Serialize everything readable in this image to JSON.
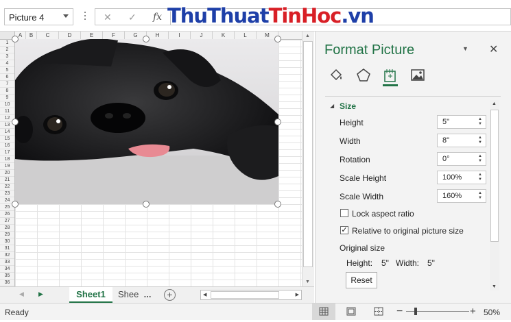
{
  "formula_bar": {
    "name_box": "Picture 4",
    "fx_label": "fx",
    "watermark_a": "ThuThuat",
    "watermark_b": "TinHoc",
    "watermark_c": ".vn"
  },
  "grid": {
    "columns": [
      "A",
      "B",
      "C",
      "D",
      "E",
      "F",
      "G",
      "H",
      "I",
      "J",
      "K",
      "L",
      "M"
    ],
    "rows": [
      "1",
      "2",
      "3",
      "4",
      "5",
      "6",
      "7",
      "8",
      "9",
      "10",
      "11",
      "12",
      "13",
      "14",
      "15",
      "16",
      "17",
      "18",
      "19",
      "20",
      "21",
      "22",
      "23",
      "24",
      "25",
      "26",
      "27",
      "28",
      "29",
      "30",
      "31",
      "32",
      "33",
      "34",
      "35",
      "36"
    ]
  },
  "sheet_tabs": {
    "active": "Sheet1",
    "other": "Shee",
    "ellipsis": "..."
  },
  "pane": {
    "title": "Format Picture",
    "section": "Size",
    "fields": [
      {
        "label": "Height",
        "value": "5\""
      },
      {
        "label": "Width",
        "value": "8\""
      },
      {
        "label": "Rotation",
        "value": "0°"
      },
      {
        "label": "Scale Height",
        "value": "100%"
      },
      {
        "label": "Scale Width",
        "value": "160%"
      }
    ],
    "lock_label": "Lock aspect ratio",
    "lock_checked": false,
    "relative_label": "Relative to original picture size",
    "relative_checked": true,
    "original_size_label": "Original size",
    "orig_height_label": "Height:",
    "orig_height_value": "5\"",
    "orig_width_label": "Width:",
    "orig_width_value": "5\"",
    "reset_label": "Reset"
  },
  "status": {
    "ready": "Ready",
    "zoom": "50%"
  },
  "colors": {
    "excel_green": "#217346",
    "watermark_blue": "#1e3fa8",
    "watermark_red": "#d81f26"
  }
}
